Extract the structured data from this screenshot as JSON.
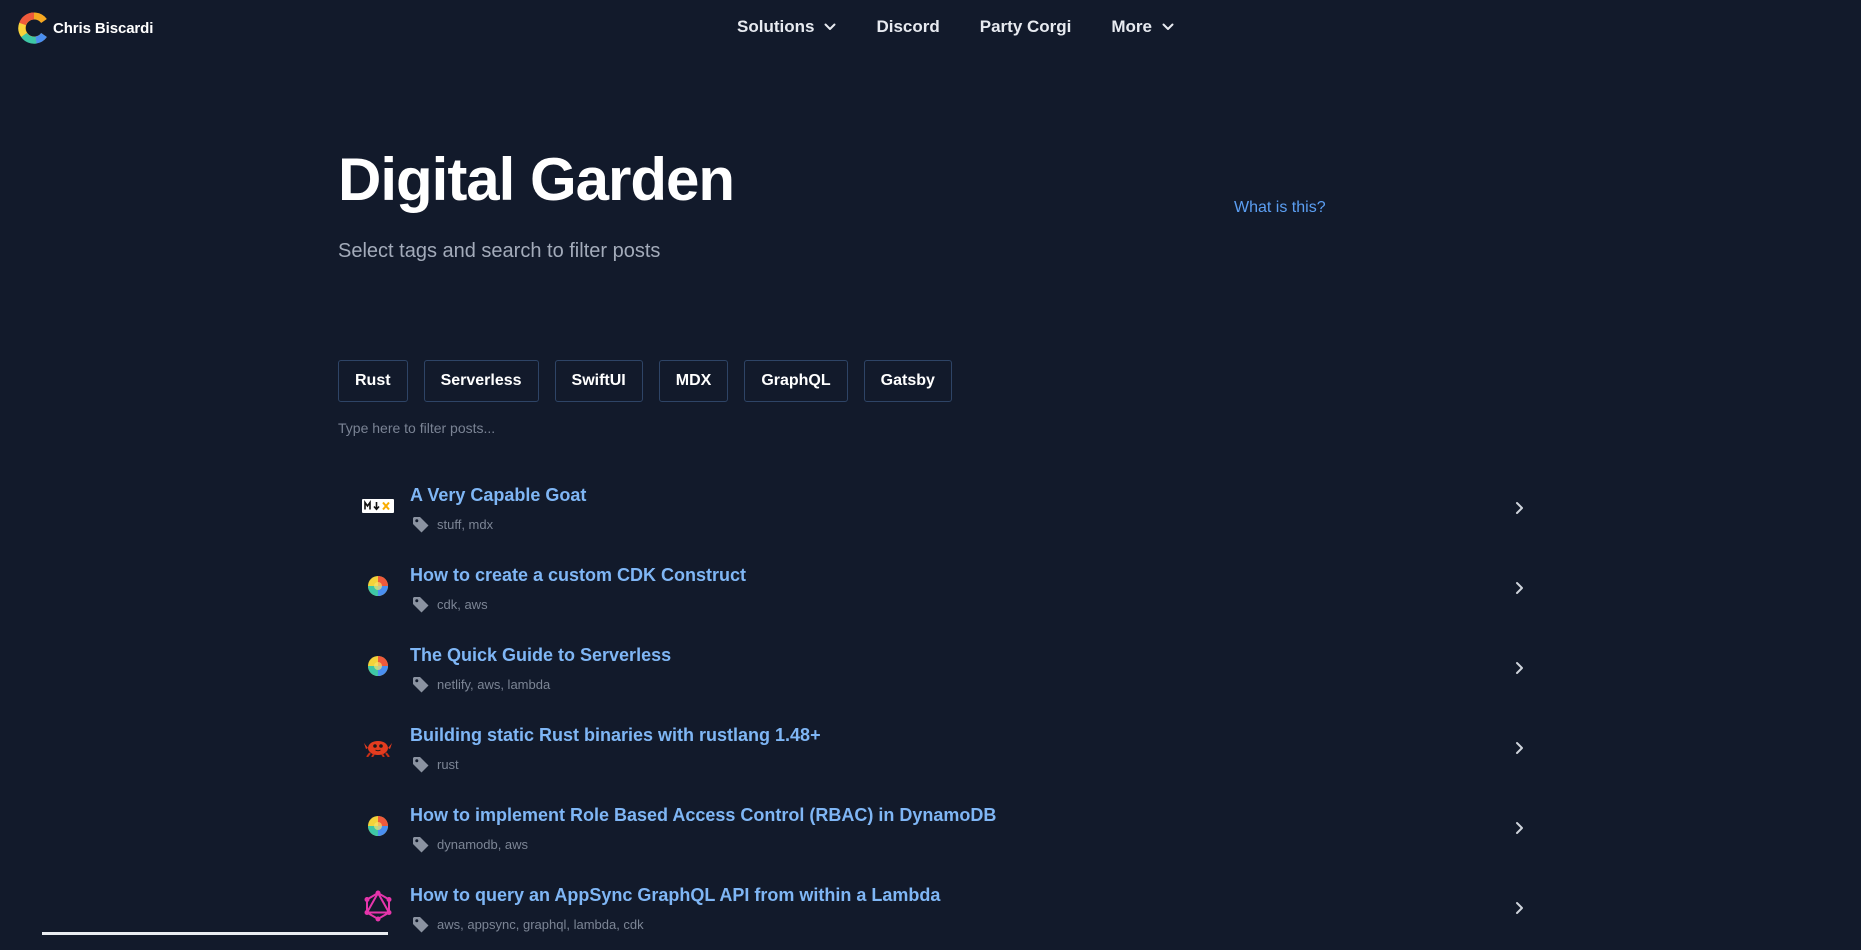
{
  "brand": {
    "name": "Chris Biscardi"
  },
  "nav": [
    {
      "label": "Solutions",
      "dropdown": true
    },
    {
      "label": "Discord",
      "dropdown": false
    },
    {
      "label": "Party Corgi",
      "dropdown": false
    },
    {
      "label": "More",
      "dropdown": true
    }
  ],
  "hero": {
    "title": "Digital Garden",
    "subtitle": "Select tags and search to filter posts",
    "what_link": "What is this?"
  },
  "tags": [
    "Rust",
    "Serverless",
    "SwiftUI",
    "MDX",
    "GraphQL",
    "Gatsby"
  ],
  "search": {
    "placeholder": "Type here to filter posts..."
  },
  "posts": [
    {
      "title": "A Very Capable Goat",
      "tags": "stuff, mdx",
      "icon": "mdx-icon"
    },
    {
      "title": "How to create a custom CDK Construct",
      "tags": "cdk, aws",
      "icon": "rainbow-ball-icon"
    },
    {
      "title": "The Quick Guide to Serverless",
      "tags": "netlify, aws, lambda",
      "icon": "rainbow-ball-icon"
    },
    {
      "title": "Building static Rust binaries with rustlang 1.48+",
      "tags": "rust",
      "icon": "ferris-crab-icon"
    },
    {
      "title": "How to implement Role Based Access Control (RBAC) in DynamoDB",
      "tags": "dynamodb, aws",
      "icon": "rainbow-ball-icon"
    },
    {
      "title": "How to query an AppSync GraphQL API from within a Lambda",
      "tags": "aws, appsync, graphql, lambda, cdk",
      "icon": "graphql-icon"
    }
  ],
  "colors": {
    "background": "#121a2b",
    "link": "#7fb6f5",
    "accent_link": "#5b9ef2",
    "tag_border": "#2e4466",
    "muted_text": "#7c8595"
  }
}
